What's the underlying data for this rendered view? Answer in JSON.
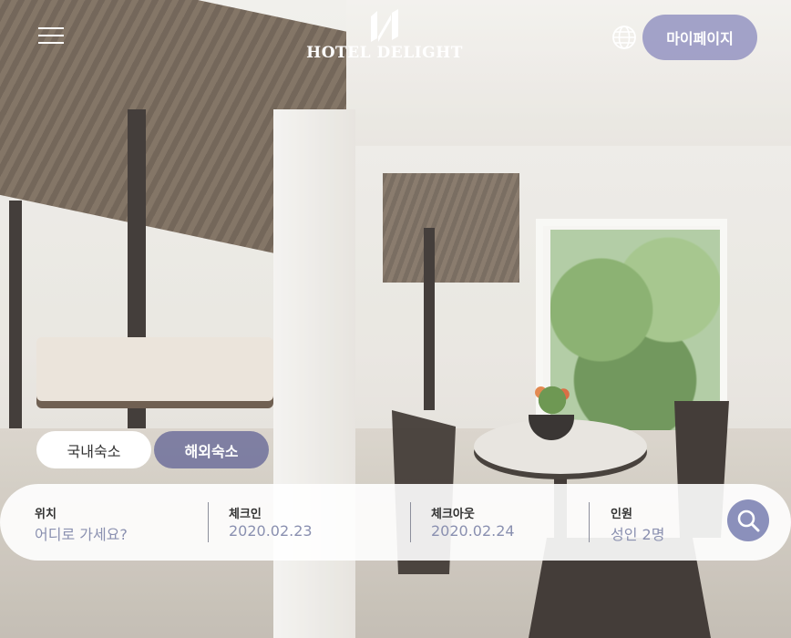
{
  "header": {
    "brand": "HOTEL DELIGHT",
    "mypage_label": "마이페이지",
    "icons": {
      "menu": "hamburger-menu-icon",
      "language": "globe-icon",
      "logo": "hotel-delight-logo"
    }
  },
  "tabs": [
    {
      "label": "국내숙소",
      "active": false
    },
    {
      "label": "해외숙소",
      "active": true
    }
  ],
  "search": {
    "location": {
      "label": "위치",
      "value": "어디로 가세요?"
    },
    "checkin": {
      "label": "체크인",
      "value": "2020.02.23"
    },
    "checkout": {
      "label": "체크아웃",
      "value": "2020.02.24"
    },
    "guests": {
      "label": "인원",
      "value": "성인 2명"
    },
    "button_icon": "search-icon"
  },
  "colors": {
    "accent": "#8b90bb",
    "mypage_bg": "#8c8cbe",
    "active_tab_bg": "#6e709b",
    "value_text": "#8a90b0"
  }
}
